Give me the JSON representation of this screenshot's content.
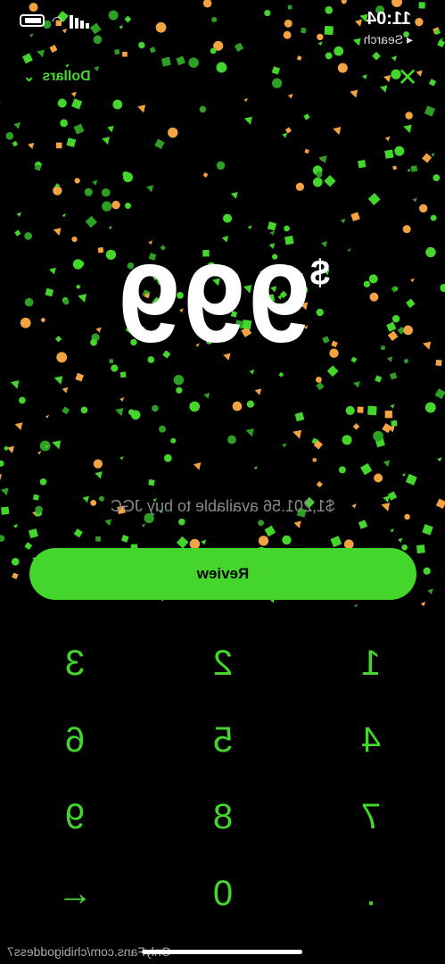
{
  "status_bar": {
    "time": "11:04",
    "back_label": "◂ Search"
  },
  "top_bar": {
    "close_icon": "close-icon",
    "currency_label": "Dollars",
    "currency_chevron": "chevron-down-icon"
  },
  "amount": {
    "currency_symbol": "$",
    "value": "999"
  },
  "available_text": "$1,201.56 available to buy JGC",
  "review_label": "Review",
  "keypad": [
    "1",
    "2",
    "3",
    "4",
    "5",
    "6",
    "7",
    "8",
    "9",
    ".",
    "0",
    "←"
  ],
  "watermark": "OnlyFans.com/chibigoddess7",
  "colors": {
    "accent": "#44d62c",
    "confetti_orange": "#f4a342",
    "background": "#000000"
  },
  "mirrored": true
}
